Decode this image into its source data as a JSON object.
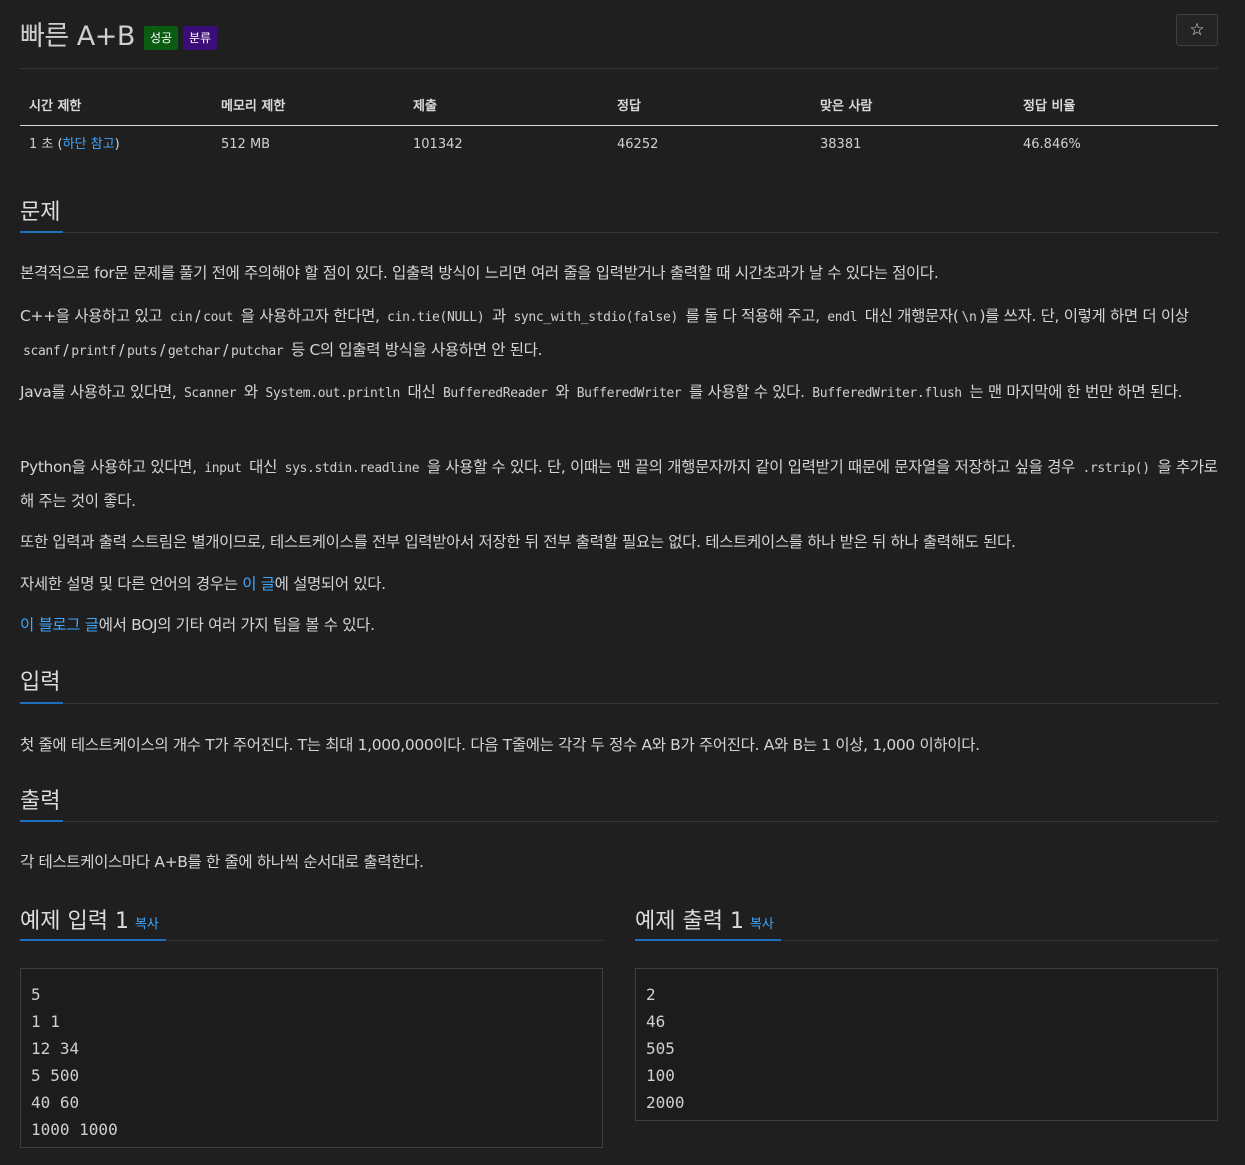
{
  "problem": {
    "title": "빠른 A+B",
    "badge_success": "성공",
    "badge_category": "분류",
    "star_icon": "☆"
  },
  "stats": {
    "headers": [
      "시간 제한",
      "메모리 제한",
      "제출",
      "정답",
      "맞은 사람",
      "정답 비율"
    ],
    "time_prefix": "1 초 (",
    "time_link": "하단 참고",
    "time_suffix": ")",
    "memory": "512 MB",
    "submissions": "101342",
    "accepted": "46252",
    "solvers": "38381",
    "ratio": "46.846%"
  },
  "sections": {
    "problem_title": "문제",
    "input_title": "입력",
    "output_title": "출력"
  },
  "description": {
    "p1": "본격적으로 for문 문제를 풀기 전에 주의해야 할 점이 있다. 입출력 방식이 느리면 여러 줄을 입력받거나 출력할 때 시간초과가 날 수 있다는 점이다.",
    "p2_a": "C++을 사용하고 있고 ",
    "p2_cin": "cin",
    "p2_slash1": "/",
    "p2_cout": "cout",
    "p2_b": " 을 사용하고자 한다면, ",
    "p2_tie": "cin.tie(NULL)",
    "p2_c": " 과 ",
    "p2_sync": "sync_with_stdio(false)",
    "p2_d": " 를 둘 다 적용해 주고, ",
    "p2_endl": "endl",
    "p2_e": " 대신 개행문자(",
    "p2_nl": "\\n",
    "p2_f": ")를 쓰자. 단, 이렇게 하면 더 이상 ",
    "p2_scanf": "scanf",
    "p2_printf": "printf",
    "p2_puts": "puts",
    "p2_getchar": "getchar",
    "p2_putchar": "putchar",
    "p2_g": " 등 C의 입출력 방식을 사용하면 안 된다.",
    "p3_a": "Java를 사용하고 있다면, ",
    "p3_scanner": "Scanner",
    "p3_b": " 와 ",
    "p3_println": "System.out.println",
    "p3_c": " 대신 ",
    "p3_reader": "BufferedReader",
    "p3_d": " 와 ",
    "p3_writer": "BufferedWriter",
    "p3_e": " 를 사용할 수 있다. ",
    "p3_flush": "BufferedWriter.flush",
    "p3_f": " 는 맨 마지막에 한 번만 하면 된다.",
    "p4_a": "Python을 사용하고 있다면, ",
    "p4_input": "input",
    "p4_b": " 대신 ",
    "p4_readline": "sys.stdin.readline",
    "p4_c": " 을 사용할 수 있다. 단, 이때는 맨 끝의 개행문자까지 같이 입력받기 때문에 문자열을 저장하고 싶을 경우 ",
    "p4_rstrip": ".rstrip()",
    "p4_d": " 을 추가로 해 주는 것이 좋다.",
    "p5": "또한 입력과 출력 스트림은 별개이므로, 테스트케이스를 전부 입력받아서 저장한 뒤 전부 출력할 필요는 없다. 테스트케이스를 하나 받은 뒤 하나 출력해도 된다.",
    "p6_a": "자세한 설명 및 다른 언어의 경우는 ",
    "p6_link": "이 글",
    "p6_b": "에 설명되어 있다.",
    "p7_link": "이 블로그 글",
    "p7_b": "에서 BOJ의 기타 여러 가지 팁을 볼 수 있다."
  },
  "input_text": "첫 줄에 테스트케이스의 개수 T가 주어진다. T는 최대 1,000,000이다. 다음 T줄에는 각각 두 정수 A와 B가 주어진다. A와 B는 1 이상, 1,000 이하이다.",
  "output_text": "각 테스트케이스마다 A+B를 한 줄에 하나씩 순서대로 출력한다.",
  "samples": {
    "input_title": "예제 입력 1",
    "output_title": "예제 출력 1",
    "copy_label": "복사",
    "input_body": "5\n1 1\n12 34\n5 500\n40 60\n1000 1000",
    "output_body": "2\n46\n505\n100\n2000"
  },
  "colors": {
    "background": "#1f1f1f",
    "link": "#3fa7ff",
    "badge_success": "#0a5c12",
    "badge_category": "#3b0d78",
    "accent": "#1e6fbf"
  }
}
